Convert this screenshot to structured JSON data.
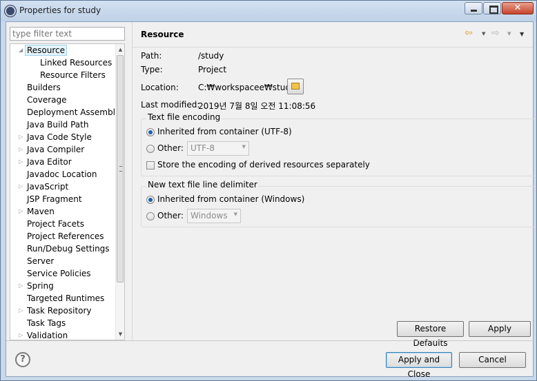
{
  "window": {
    "title": "Properties for study"
  },
  "filter": {
    "placeholder": "type filter text"
  },
  "tree": {
    "items": [
      {
        "label": "Resource",
        "expanded": true,
        "selected": true
      },
      {
        "label": "Linked Resources"
      },
      {
        "label": "Resource Filters"
      },
      {
        "label": "Builders"
      },
      {
        "label": "Coverage"
      },
      {
        "label": "Deployment Assembly"
      },
      {
        "label": "Java Build Path"
      },
      {
        "label": "Java Code Style",
        "expandable": true
      },
      {
        "label": "Java Compiler",
        "expandable": true
      },
      {
        "label": "Java Editor",
        "expandable": true
      },
      {
        "label": "Javadoc Location"
      },
      {
        "label": "JavaScript",
        "expandable": true
      },
      {
        "label": "JSP Fragment"
      },
      {
        "label": "Maven",
        "expandable": true
      },
      {
        "label": "Project Facets"
      },
      {
        "label": "Project References"
      },
      {
        "label": "Run/Debug Settings"
      },
      {
        "label": "Server"
      },
      {
        "label": "Service Policies"
      },
      {
        "label": "Spring",
        "expandable": true
      },
      {
        "label": "Targeted Runtimes"
      },
      {
        "label": "Task Repository",
        "expandable": true
      },
      {
        "label": "Task Tags"
      },
      {
        "label": "Validation",
        "expandable": true
      }
    ]
  },
  "page": {
    "title": "Resource",
    "path_label": "Path:",
    "path_value": "/study",
    "type_label": "Type:",
    "type_value": "Project",
    "location_label": "Location:",
    "location_value": "C:₩workspacee₩study",
    "modified_label": "Last modified:",
    "modified_value": "2019년 7월 8일 오전 11:08:56",
    "encoding": {
      "title": "Text file encoding",
      "inherited_label": "Inherited from container (UTF-8)",
      "other_label": "Other:",
      "other_value": "UTF-8",
      "store_label": "Store the encoding of derived resources separately"
    },
    "delimiter": {
      "title": "New text file line delimiter",
      "inherited_label": "Inherited from container (Windows)",
      "other_label": "Other:",
      "other_value": "Windows"
    }
  },
  "buttons": {
    "restore_defaults": "Restore Defaults",
    "apply": "Apply",
    "apply_and_close": "Apply and Close",
    "cancel": "Cancel"
  },
  "icons": {
    "help": "?",
    "close": "✕",
    "nav_back": "⇦",
    "nav_forward": "⇨"
  }
}
